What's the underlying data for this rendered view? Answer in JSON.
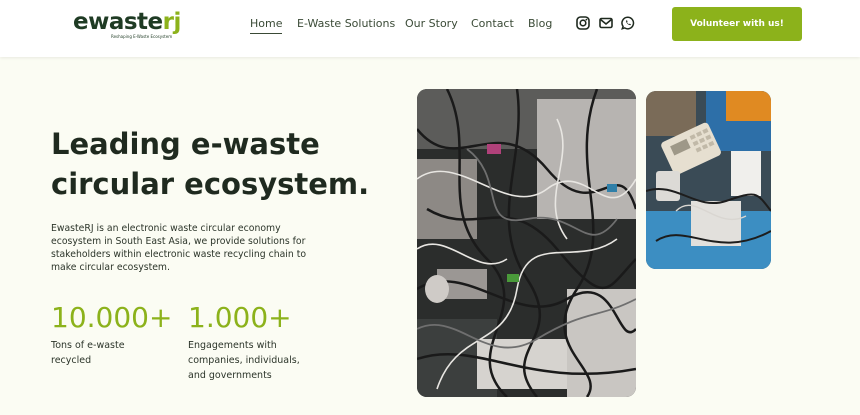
{
  "brand": {
    "name_main": "ewaste",
    "name_accent": "rj",
    "tagline": "Reshaping E-Waste Ecosystem",
    "accent_color": "#8cb21b",
    "dark_color": "#1f3b24"
  },
  "nav": {
    "items": [
      {
        "label": "Home",
        "active": true
      },
      {
        "label": "E-Waste Solutions",
        "active": false
      },
      {
        "label": "Our Story",
        "active": false
      },
      {
        "label": "Contact",
        "active": false
      },
      {
        "label": "Blog",
        "active": false
      }
    ]
  },
  "social": {
    "icons": [
      "instagram-icon",
      "mail-icon",
      "whatsapp-icon"
    ]
  },
  "cta": {
    "volunteer_label": "Volunteer with us!"
  },
  "hero": {
    "title_line1": "Leading e-waste",
    "title_line2": "circular ecosystem.",
    "description": "EwasteRJ is an electronic waste circular economy ecosystem in South East Asia, we provide solutions for stakeholders within electronic waste recycling chain to make circular ecosystem."
  },
  "stats": [
    {
      "value": "10.000+",
      "label_line1": "Tons of e-waste",
      "label_line2": "recycled",
      "label_line3": ""
    },
    {
      "value": "1.000+",
      "label_line1": "Engagements with",
      "label_line2": "companies, individuals,",
      "label_line3": "and governments"
    }
  ]
}
